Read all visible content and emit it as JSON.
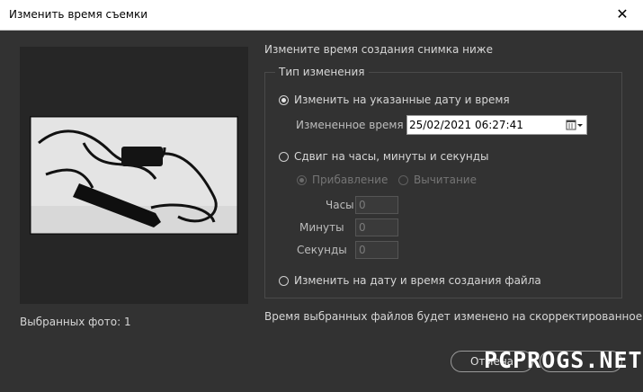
{
  "window": {
    "title": "Изменить время съемки",
    "close_glyph": "✕"
  },
  "preview": {
    "selected_label": "Выбранных фото: 1"
  },
  "instruction": "Измените время создания снимка ниже",
  "group": {
    "legend": "Тип изменения",
    "option_specific": "Изменить на указанные дату и время",
    "changed_time_label": "Измененное время",
    "changed_time_value": "25/02/2021   06:27:41",
    "option_shift": "Сдвиг на часы, минуты и секунды",
    "add_label": "Прибавление",
    "subtract_label": "Вычитание",
    "hours_label": "Часы",
    "hours_value": "0",
    "minutes_label": "Минуты",
    "minutes_value": "0",
    "seconds_label": "Секунды",
    "seconds_value": "0",
    "option_file": "Изменить на дату и время создания файла"
  },
  "note": "Время выбранных файлов будет изменено на скорректированное",
  "buttons": {
    "cancel": "Отмена"
  },
  "watermark": "PCPROGS.NET",
  "icons": {
    "close": "close-icon",
    "calendar": "calendar-icon",
    "dropdown": "chevron-down-icon"
  }
}
